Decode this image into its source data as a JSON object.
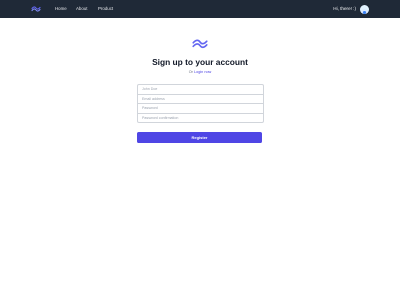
{
  "nav": {
    "logo_icon": "tailwind-wave-icon",
    "links": [
      "Home",
      "About",
      "Product"
    ],
    "greeting": "Hi, there! :)",
    "avatar_icon": "user-avatar-icon"
  },
  "hero": {
    "logo_icon": "tailwind-wave-icon",
    "title": "Sign up to your account",
    "subtitle_prefix": "Or",
    "subtitle_link": "Login now"
  },
  "form": {
    "name_placeholder": "John Doe",
    "email_placeholder": "Email address",
    "password_placeholder": "Password",
    "password_confirm_placeholder": "Password confirmation",
    "submit_label": "Register"
  },
  "colors": {
    "navbar_bg": "#1f2937",
    "accent": "#4f46e5",
    "logo": "#6366f1"
  }
}
